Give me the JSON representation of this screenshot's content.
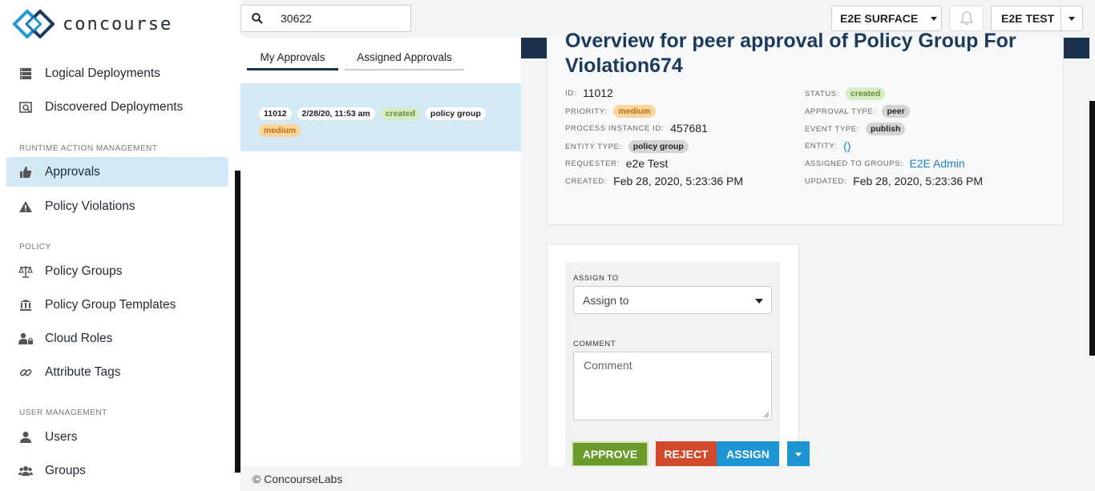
{
  "app": {
    "name": "concourse"
  },
  "sidebar": {
    "items": [
      {
        "label": "Logical Deployments",
        "icon": "server-stack-icon"
      },
      {
        "label": "Discovered Deployments",
        "icon": "discover-icon"
      },
      {
        "label": "Approvals",
        "icon": "thumbs-up-icon"
      },
      {
        "label": "Policy Violations",
        "icon": "warning-icon"
      },
      {
        "label": "Policy Groups",
        "icon": "balance-scale-icon"
      },
      {
        "label": "Policy Group Templates",
        "icon": "institution-icon"
      },
      {
        "label": "Cloud Roles",
        "icon": "user-lock-icon"
      },
      {
        "label": "Attribute Tags",
        "icon": "link-icon"
      },
      {
        "label": "Users",
        "icon": "user-icon"
      },
      {
        "label": "Groups",
        "icon": "users-icon"
      }
    ],
    "sections": {
      "runtime": "RUNTIME ACTION MANAGEMENT",
      "policy": "POLICY",
      "user": "USER MANAGEMENT"
    }
  },
  "search": {
    "value": "30622"
  },
  "header": {
    "surface": "E2E SURFACE",
    "org": "E2E TEST"
  },
  "tabs": {
    "my": "My Approvals",
    "assigned": "Assigned Approvals"
  },
  "list": {
    "row": {
      "id": "11012",
      "date": "2/28/20, 11:53 am",
      "status": "created",
      "type": "policy group",
      "priority": "medium"
    }
  },
  "detail": {
    "title": "Overview for peer approval of Policy Group For Violation674",
    "labels": {
      "id": "ID:",
      "priority": "PRIORITY:",
      "process": "PROCESS INSTANCE ID:",
      "entity_type": "ENTITY TYPE:",
      "requester": "REQUESTER:",
      "created": "CREATED:",
      "status": "STATUS:",
      "approval_type": "APPROVAL TYPE:",
      "event_type": "EVENT TYPE:",
      "entity": "ENTITY:",
      "groups": "ASSIGNED TO GROUPS:",
      "updated": "UPDATED:"
    },
    "values": {
      "id": "11012",
      "priority": "medium",
      "process": "457681",
      "entity_type": "policy group",
      "requester": "e2e Test",
      "created": "Feb 28, 2020, 5:23:36 PM",
      "status": "created",
      "approval_type": "peer",
      "event_type": "publish",
      "entity": "()",
      "groups": "E2E Admin",
      "updated": "Feb 28, 2020, 5:23:36 PM"
    }
  },
  "action": {
    "assign_label": "ASSIGN TO",
    "assign_placeholder": "Assign to",
    "comment_label": "COMMENT",
    "comment_placeholder": "Comment",
    "approve": "APPROVE",
    "reject": "REJECT",
    "assign": "ASSIGN"
  },
  "footer": {
    "text": "© ConcourseLabs"
  },
  "colors": {
    "navy": "#1a3250",
    "active_bg": "#d3e9f6",
    "approve": "#6a9a2a",
    "reject": "#d24a2c",
    "assign": "#1d95d4",
    "chip_created": "#d6ecc4",
    "chip_medium": "#fbd59a",
    "chip_gray": "#d4d4d4"
  }
}
